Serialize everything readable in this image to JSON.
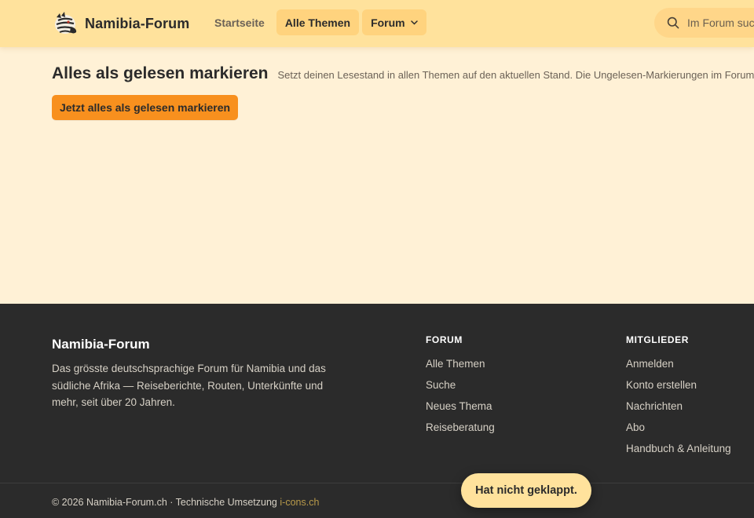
{
  "header": {
    "brand_name": "Namibia-Forum",
    "logo_icon": "zebra-logo-icon",
    "nav": {
      "home_label": "Startseite",
      "all_topics_label": "Alle Themen",
      "forum_label": "Forum"
    },
    "search": {
      "placeholder": "Im Forum suchen…",
      "visible_text": "Im Forum suc"
    },
    "colors": {
      "header_bg": "#ffe29c",
      "pill_bg": "#ffd37e"
    }
  },
  "main": {
    "title": "Alles als gelesen markieren",
    "description": "Setzt deinen Lesestand in allen Themen auf den aktuellen Stand. Die Ungelesen-Markierungen im Forum verschwinden.",
    "cta_label": "Jetzt alles als gelesen markieren",
    "colors": {
      "page_bg": "#fff1d6",
      "cta_bg": "#f8901e"
    }
  },
  "footer": {
    "brand_name": "Namibia-Forum",
    "description": "Das grösste deutschsprachige Forum für Namibia und das südliche Afrika — Reiseberichte, Routen, Unterkünfte und mehr, seit über 20 Jahren.",
    "forum_heading": "FORUM",
    "forum_links": [
      "Alle Themen",
      "Suche",
      "Neues Thema",
      "Reiseberatung"
    ],
    "members_heading": "MITGLIEDER",
    "members_links": [
      "Anmelden",
      "Konto erstellen",
      "Nachrichten",
      "Abo",
      "Handbuch & Anleitung"
    ],
    "copyright": "© 2026 Namibia-Forum.ch · Technische Umsetzung",
    "credit_link": "i-cons.ch",
    "colors": {
      "footer_bg": "#2b2b2b"
    }
  },
  "toast": {
    "message": "Hat nicht geklappt."
  }
}
